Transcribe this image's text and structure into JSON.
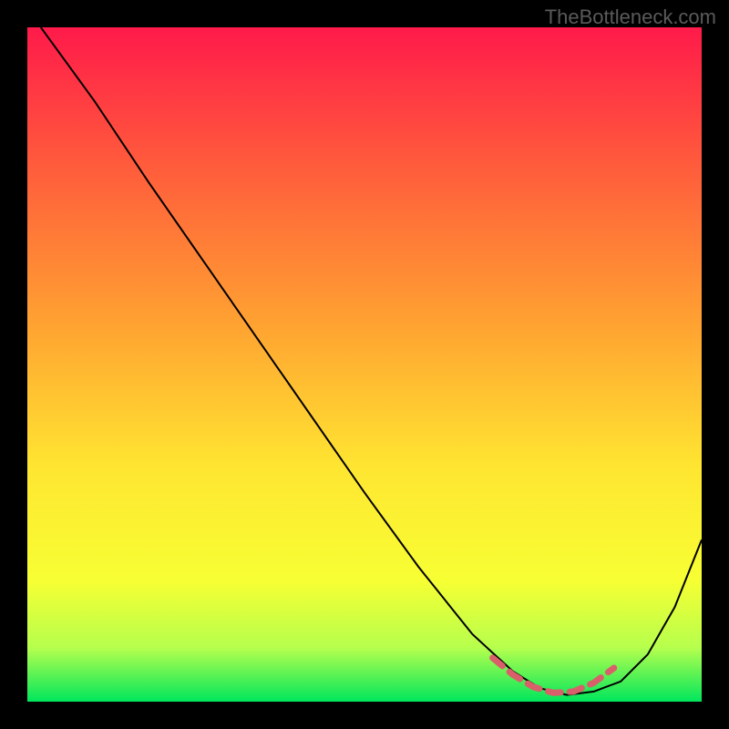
{
  "watermark": "TheBottleneck.com",
  "chart_data": {
    "type": "line",
    "title": "",
    "xlabel": "",
    "ylabel": "",
    "xlim": [
      0,
      100
    ],
    "ylim": [
      0,
      100
    ],
    "gradient_stops": [
      {
        "offset": 0,
        "color": "#ff1a4a"
      },
      {
        "offset": 20,
        "color": "#ff5a3c"
      },
      {
        "offset": 45,
        "color": "#ffa531"
      },
      {
        "offset": 65,
        "color": "#ffe531"
      },
      {
        "offset": 82,
        "color": "#f7ff33"
      },
      {
        "offset": 92,
        "color": "#b6ff4d"
      },
      {
        "offset": 100,
        "color": "#00e65c"
      }
    ],
    "series": [
      {
        "name": "bottleneck-curve",
        "type": "line",
        "color": "#000000",
        "x": [
          2,
          10,
          18,
          26,
          34,
          42,
          50,
          58,
          66,
          72,
          76,
          80,
          84,
          88,
          92,
          96,
          100
        ],
        "y": [
          100,
          89,
          77,
          65.5,
          54,
          42.5,
          31,
          20,
          10,
          4.5,
          2,
          1,
          1.5,
          3,
          7,
          14,
          24
        ]
      },
      {
        "name": "optimal-range-marker",
        "type": "line",
        "color": "#d9606a",
        "stroke_width": 7,
        "dash": "14 10",
        "x": [
          69,
          72,
          75,
          78,
          81,
          84,
          87
        ],
        "y": [
          6.5,
          4,
          2.2,
          1.3,
          1.5,
          2.8,
          5
        ]
      }
    ],
    "annotations": []
  }
}
